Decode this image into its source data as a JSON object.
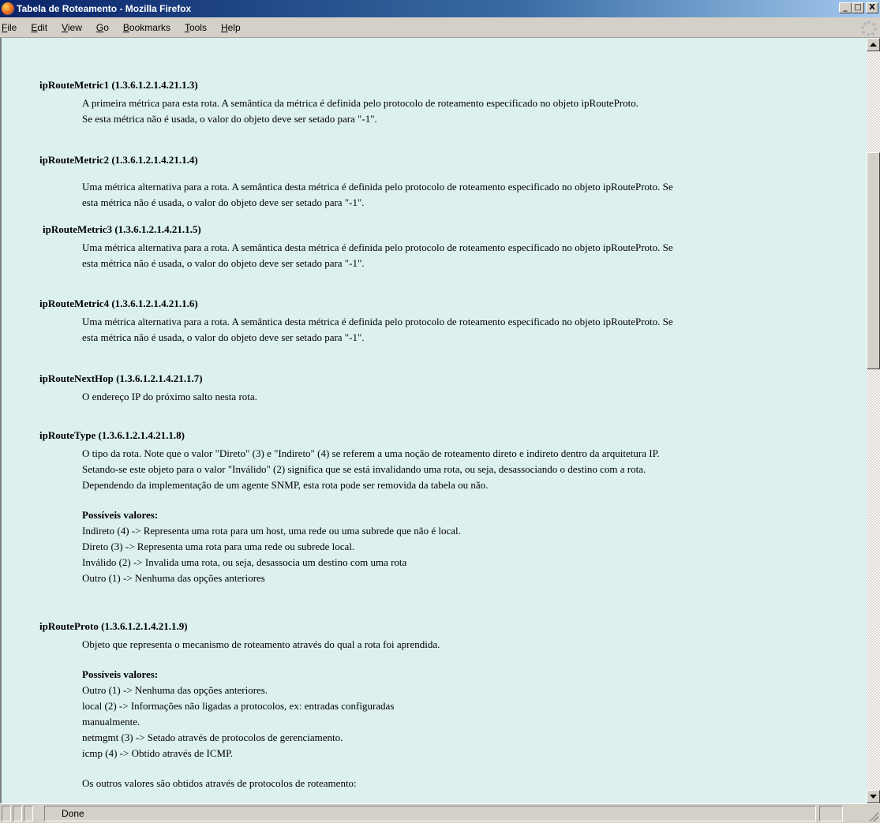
{
  "window": {
    "title": "Tabela de Roteamento - Mozilla Firefox",
    "minimize": "_",
    "maximize": "□",
    "close": "X"
  },
  "menu": [
    {
      "label": "File",
      "accel": "F",
      "rest": "ile"
    },
    {
      "label": "Edit",
      "accel": "E",
      "rest": "dit"
    },
    {
      "label": "View",
      "accel": "V",
      "rest": "iew"
    },
    {
      "label": "Go",
      "accel": "G",
      "rest": "o"
    },
    {
      "label": "Bookmarks",
      "accel": "B",
      "rest": "ookmarks"
    },
    {
      "label": "Tools",
      "accel": "T",
      "rest": "ools"
    },
    {
      "label": "Help",
      "accel": "H",
      "rest": "elp"
    }
  ],
  "entries": [
    {
      "title": "ipRouteMetric1 (1.3.6.1.2.1.4.21.1.3)",
      "desc": [
        "A primeira métrica para esta rota. A semântica da métrica é definida pelo protocolo de roteamento especificado no objeto ipRouteProto.",
        "Se esta métrica não é usada, o valor do objeto deve ser setado para \"-1\"."
      ]
    },
    {
      "title": "ipRouteMetric2 (1.3.6.1.2.1.4.21.1.4)",
      "desc": [
        "Uma métrica alternativa para a rota. A semântica desta métrica é definida pelo protocolo de roteamento especificado no objeto ipRouteProto. Se",
        "esta métrica não é usada, o valor do objeto deve ser setado para \"-1\"."
      ]
    },
    {
      "title": "ipRouteMetric3 (1.3.6.1.2.1.4.21.1.5)",
      "desc": [
        "Uma métrica alternativa para a rota. A semântica desta métrica é definida pelo protocolo de roteamento especificado no objeto ipRouteProto. Se",
        "esta métrica não é usada, o valor do objeto deve ser setado para \"-1\"."
      ]
    },
    {
      "title": "ipRouteMetric4 (1.3.6.1.2.1.4.21.1.6)",
      "desc": [
        "Uma métrica alternativa para a rota. A semântica desta métrica é definida pelo protocolo de roteamento especificado no objeto ipRouteProto. Se",
        "esta métrica não é usada, o valor do objeto deve ser setado para \"-1\"."
      ]
    },
    {
      "title": "ipRouteNextHop (1.3.6.1.2.1.4.21.1.7)",
      "desc": [
        "O endereço IP do próximo salto nesta rota."
      ]
    },
    {
      "title": "ipRouteType (1.3.6.1.2.1.4.21.1.8)",
      "desc": [
        "O tipo da rota. Note que o valor \"Direto\" (3) e \"Indireto\" (4) se referem a uma noção de roteamento direto e indireto dentro da arquitetura IP.",
        "Setando-se este objeto para o valor \"Inválido\" (2) significa que se está invalidando uma rota, ou seja, desassociando o destino com a rota.",
        "Dependendo da implementação de um agente SNMP, esta rota pode ser removida da tabela ou não."
      ],
      "values_title": "Possíveis valores:",
      "values": [
        "Indireto (4) -> Representa uma rota para um host, uma rede ou uma subrede que não é local.",
        "Direto (3) -> Representa uma rota para uma rede ou subrede local.",
        "Inválido (2) -> Invalida uma rota, ou seja, desassocia um destino com uma rota",
        "Outro (1) -> Nenhuma das opções anteriores"
      ]
    },
    {
      "title": "ipRouteProto (1.3.6.1.2.1.4.21.1.9)",
      "desc": [
        "Objeto que representa o mecanismo de roteamento através do qual a rota foi aprendida."
      ],
      "values_title": "Possíveis valores:",
      "values": [
        "Outro (1) -> Nenhuma das opções anteriores.",
        "local (2) -> Informações não ligadas a protocolos, ex: entradas configuradas",
        "manualmente.",
        "netmgmt (3) -> Setado através de protocolos de gerenciamento.",
        "icmp (4) -> Obtido através de ICMP."
      ],
      "extra": "Os outros valores são obtidos através de protocolos de roteamento:"
    }
  ],
  "status": {
    "text": "Done"
  }
}
